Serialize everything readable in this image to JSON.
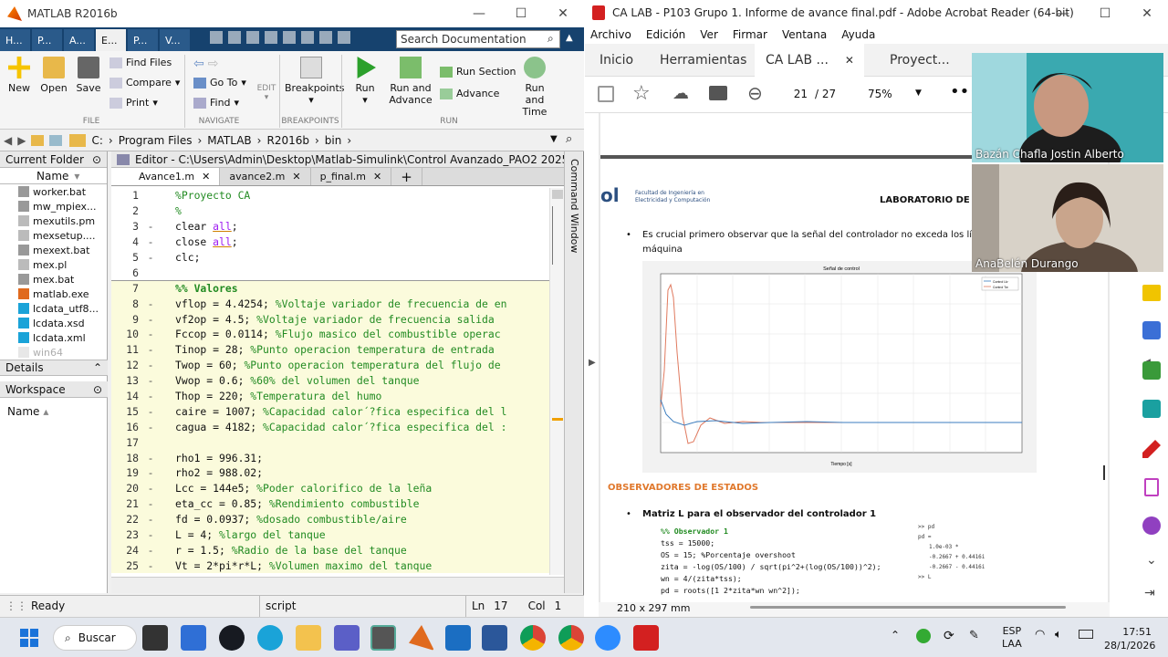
{
  "matlab": {
    "title": "MATLAB R2016b",
    "top_tabs": [
      "H...",
      "P...",
      "A...",
      "E...",
      "P...",
      "V..."
    ],
    "search_placeholder": "Search Documentation",
    "ribbon": {
      "new": "New",
      "open": "Open",
      "save": "Save",
      "find_files": "Find Files",
      "compare": "Compare",
      "print": "Print",
      "go_to": "Go To",
      "find": "Find",
      "edit": "EDIT",
      "breakpoints": "Breakpoints",
      "run": "Run",
      "run_and_advance": "Run and Advance",
      "run_section": "Run Section",
      "advance": "Advance",
      "run_and_time": "Run and Time",
      "group_file": "FILE",
      "group_navigate": "NAVIGATE",
      "group_breakpoints": "BREAKPOINTS",
      "group_run": "RUN"
    },
    "path": [
      "C:",
      "Program Files",
      "MATLAB",
      "R2016b",
      "bin"
    ],
    "current_folder": {
      "title": "Current Folder",
      "col_name": "Name",
      "files": [
        "worker.bat",
        "mw_mpiex...",
        "mexutils.pm",
        "mexsetup....",
        "mexext.bat",
        "mex.pl",
        "mex.bat",
        "matlab.exe",
        "lcdata_utf8...",
        "lcdata.xsd",
        "lcdata.xml",
        "win64"
      ]
    },
    "details": "Details",
    "workspace": "Workspace",
    "ws_col_name": "Name",
    "editor": {
      "title": "Editor - C:\\Users\\Admin\\Desktop\\Matlab-Simulink\\Control Avanzado_PAO2 2025\\Pr...",
      "tabs": [
        "Avance1.m",
        "avance2.m",
        "p_final.m"
      ],
      "command_window": "Command Window"
    },
    "code_lines": [
      {
        "n": "1",
        "segs": [
          [
            "c",
            "%Proyecto CA"
          ]
        ]
      },
      {
        "n": "2",
        "segs": [
          [
            "c",
            "%"
          ]
        ]
      },
      {
        "n": "3",
        "segs": [
          [
            "k",
            "clear "
          ],
          [
            "s",
            "all"
          ],
          [
            "t",
            ";"
          ]
        ]
      },
      {
        "n": "4",
        "segs": [
          [
            "k",
            "close "
          ],
          [
            "s",
            "all"
          ],
          [
            "t",
            ";"
          ]
        ]
      },
      {
        "n": "5",
        "segs": [
          [
            "t",
            "clc;"
          ]
        ]
      },
      {
        "n": "6",
        "segs": []
      },
      {
        "n": "7",
        "segs": [
          [
            "c",
            "%% Valores"
          ]
        ]
      },
      {
        "n": "8",
        "segs": [
          [
            "t",
            "vflop = 4.4254; "
          ],
          [
            "c",
            "%Voltaje variador de frecuencia de en"
          ]
        ]
      },
      {
        "n": "9",
        "segs": [
          [
            "t",
            "vf2op = 4.5; "
          ],
          [
            "c",
            "%Voltaje variador de frecuencia salida"
          ]
        ]
      },
      {
        "n": "10",
        "segs": [
          [
            "t",
            "Fccop = 0.0114; "
          ],
          [
            "c",
            "%Flujo masico del combustible operac"
          ]
        ]
      },
      {
        "n": "11",
        "segs": [
          [
            "t",
            "Tinop = 28; "
          ],
          [
            "c",
            "%Punto operacion temperatura de entrada"
          ]
        ]
      },
      {
        "n": "12",
        "segs": [
          [
            "t",
            "Twop = 60; "
          ],
          [
            "c",
            "%Punto operacion temperatura del flujo de"
          ]
        ]
      },
      {
        "n": "13",
        "segs": [
          [
            "t",
            "Vwop = 0.6; "
          ],
          [
            "c",
            "%60% del volumen del tanque"
          ]
        ]
      },
      {
        "n": "14",
        "segs": [
          [
            "t",
            "Thop = 220; "
          ],
          [
            "c",
            "%Temperatura del humo"
          ]
        ]
      },
      {
        "n": "15",
        "segs": [
          [
            "t",
            "caire = 1007; "
          ],
          [
            "c",
            "%Capacidad calor´?fica especifica del l"
          ]
        ]
      },
      {
        "n": "16",
        "segs": [
          [
            "t",
            "cagua = 4182; "
          ],
          [
            "c",
            "%Capacidad calor´?fica especifica del :"
          ]
        ]
      },
      {
        "n": "17",
        "segs": []
      },
      {
        "n": "18",
        "segs": [
          [
            "t",
            "rho1 = 996.31;"
          ]
        ]
      },
      {
        "n": "19",
        "segs": [
          [
            "t",
            "rho2 = 988.02;"
          ]
        ]
      },
      {
        "n": "20",
        "segs": [
          [
            "t",
            "Lcc = 144e5; "
          ],
          [
            "c",
            "%Poder calorifico de la leña"
          ]
        ]
      },
      {
        "n": "21",
        "segs": [
          [
            "t",
            "eta_cc = 0.85; "
          ],
          [
            "c",
            "%Rendimiento combustible"
          ]
        ]
      },
      {
        "n": "22",
        "segs": [
          [
            "t",
            "fd = 0.0937; "
          ],
          [
            "c",
            "%dosado combustible/aire"
          ]
        ]
      },
      {
        "n": "23",
        "segs": [
          [
            "t",
            "L = 4; "
          ],
          [
            "c",
            "%largo del tanque"
          ]
        ]
      },
      {
        "n": "24",
        "segs": [
          [
            "t",
            "r = 1.5; "
          ],
          [
            "c",
            "%Radio de la base del tanque"
          ]
        ]
      },
      {
        "n": "25",
        "segs": [
          [
            "t",
            "Vt = 2*pi*r*L; "
          ],
          [
            "c",
            "%Volumen maximo del tanque"
          ]
        ]
      }
    ],
    "status": {
      "ready": "Ready",
      "type": "script",
      "ln_label": "Ln",
      "ln": "17",
      "col_label": "Col",
      "col": "1"
    }
  },
  "acrobat": {
    "title": "CA LAB - P103 Grupo 1. Informe de avance final.pdf - Adobe Acrobat Reader (64-bit)",
    "menu": [
      "Archivo",
      "Edición",
      "Ver",
      "Firmar",
      "Ventana",
      "Ayuda"
    ],
    "tabs": {
      "home": "Inicio",
      "tools": "Herramientas",
      "doc": "CA LAB ...",
      "other": "Proyect..."
    },
    "page_current": "21",
    "page_total": "/ 27",
    "zoom": "75%",
    "page_size": "210 x 297 mm",
    "doc": {
      "logo_text": "Facultad de Ingeniería en Electricidad y Computación",
      "logo_prefix": "ol",
      "lab_header": "LABORATORIO DE",
      "bullet1_line1": "Es crucial primero observar que la señal del controlador no exceda los lír",
      "bullet1_line2": "máquina",
      "plot_title": "Señal de control",
      "plot_xlabel": "Tiempo [s]",
      "plot_legend": [
        "Control Uv",
        "Control Tw"
      ],
      "section": "OBSERVADORES DE ESTADOS",
      "bullet2": "Matriz L para el observador del controlador 1",
      "code": [
        "%% Observador 1",
        "tss = 15000;",
        "OS = 15; %Porcentaje overshoot",
        "zita = -log(OS/100) / sqrt(pi^2+(log(OS/100))^2);",
        "wn = 4/(zita*tss);",
        "pd = roots([1 2*zita*wn wn^2]);"
      ],
      "console": [
        ">> pd",
        "pd =",
        "1.0e-03 *",
        "-0.2667 + 0.4416i",
        "-0.2667 - 0.4416i",
        ">> L"
      ]
    }
  },
  "video": {
    "p1": "Bazán Chafla Jostin Alberto",
    "p2": "AnaBelén Durango"
  },
  "taskbar": {
    "search": "Buscar",
    "lang1": "ESP",
    "lang2": "LAA",
    "time": "17:51",
    "date": "28/1/2026"
  },
  "colors": {
    "matlab_blue": "#16426e",
    "acrobat_red": "#d32020",
    "comment": "#228b22",
    "keyword": "#0000ff",
    "string": "#a020f0",
    "cell_bg": "#fbfbdc",
    "orange_heading": "#e0782c"
  }
}
